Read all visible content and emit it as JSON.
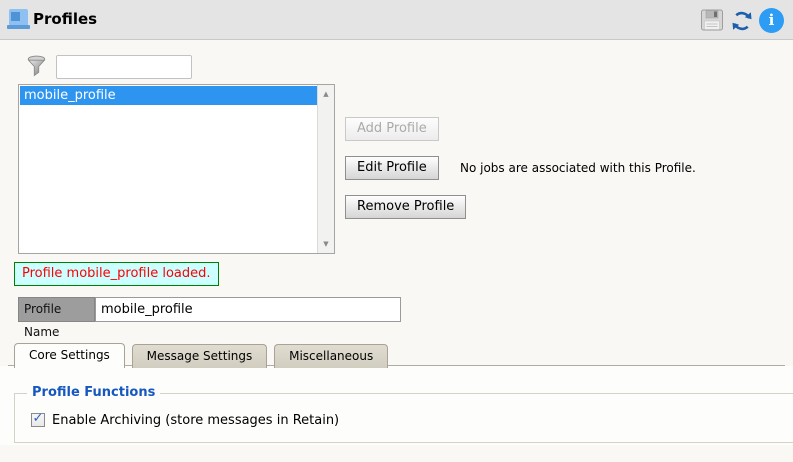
{
  "header": {
    "title": "Profiles"
  },
  "filter": {
    "value": ""
  },
  "profile_list": [
    {
      "label": "mobile_profile",
      "selected": true
    }
  ],
  "buttons": {
    "add": "Add Profile",
    "edit": "Edit Profile",
    "remove": "Remove Profile"
  },
  "messages": {
    "jobs_note": "No jobs are associated with this Profile.",
    "status": "Profile mobile_profile loaded."
  },
  "profile_name": {
    "label": "Profile Name",
    "value": "mobile_profile"
  },
  "tabs": [
    {
      "label": "Core Settings",
      "active": true
    },
    {
      "label": "Message Settings",
      "active": false
    },
    {
      "label": "Miscellaneous",
      "active": false
    }
  ],
  "core_settings": {
    "group_title": "Profile Functions",
    "checkboxes": [
      {
        "label": "Enable Archiving (store messages in Retain)",
        "checked": true
      }
    ]
  },
  "icons": {
    "info_letter": "i",
    "scroll_up": "▲",
    "scroll_down": "▼",
    "check": "✓"
  },
  "colors": {
    "selection_blue": "#2d95f0",
    "status_bg": "#ccffff",
    "status_border": "#008000",
    "status_text": "#ff0000",
    "legend_blue": "#1658c0",
    "accent_blue": "#2c9cf4",
    "header_bg": "#e4e4e4"
  }
}
